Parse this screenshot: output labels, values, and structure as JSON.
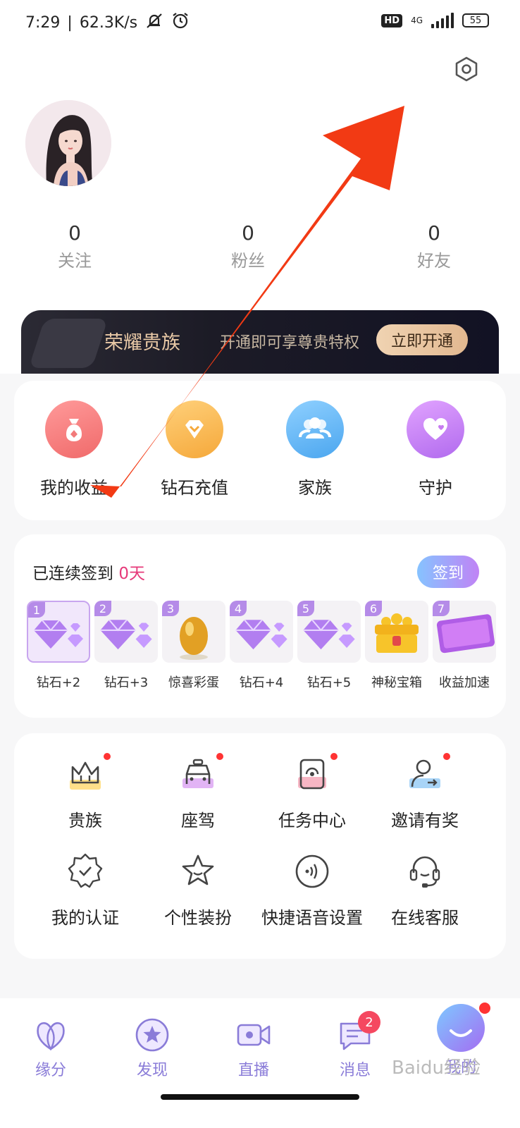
{
  "status": {
    "time": "7:29",
    "speed": "62.3K/s",
    "hd": "HD",
    "network": "4G",
    "battery": "55"
  },
  "profile": {
    "stats": [
      {
        "value": "0",
        "label": "关注"
      },
      {
        "value": "0",
        "label": "粉丝"
      },
      {
        "value": "0",
        "label": "好友"
      }
    ]
  },
  "vip": {
    "title": "荣耀贵族",
    "subtitle": "开通即可享尊贵特权",
    "button": "立即开通"
  },
  "quick_actions": [
    {
      "label": "我的收益",
      "icon": "money-bag-icon",
      "color": "#f27a7a"
    },
    {
      "label": "钻石充值",
      "icon": "diamond-icon",
      "color": "#f7b648"
    },
    {
      "label": "家族",
      "icon": "group-icon",
      "color": "#5aaef2"
    },
    {
      "label": "守护",
      "icon": "heart-icon",
      "color": "#c77cf0"
    }
  ],
  "signin": {
    "title": "已连续签到",
    "days": "0天",
    "button": "签到",
    "rewards": [
      {
        "day": "1",
        "label": "钻石+2"
      },
      {
        "day": "2",
        "label": "钻石+3"
      },
      {
        "day": "3",
        "label": "惊喜彩蛋"
      },
      {
        "day": "4",
        "label": "钻石+4"
      },
      {
        "day": "5",
        "label": "钻石+5"
      },
      {
        "day": "6",
        "label": "神秘宝箱"
      },
      {
        "day": "7",
        "label": "收益加速"
      }
    ]
  },
  "features": [
    {
      "label": "贵族",
      "icon": "crown-icon"
    },
    {
      "label": "座驾",
      "icon": "car-icon"
    },
    {
      "label": "任务中心",
      "icon": "task-icon"
    },
    {
      "label": "邀请有奖",
      "icon": "invite-icon"
    },
    {
      "label": "我的认证",
      "icon": "verified-icon"
    },
    {
      "label": "个性装扮",
      "icon": "star-icon"
    },
    {
      "label": "快捷语音设置",
      "icon": "voice-icon"
    },
    {
      "label": "在线客服",
      "icon": "headset-icon"
    }
  ],
  "tabs": [
    {
      "label": "缘分",
      "icon": "fate-icon"
    },
    {
      "label": "发现",
      "icon": "discover-icon"
    },
    {
      "label": "直播",
      "icon": "live-icon"
    },
    {
      "label": "消息",
      "icon": "message-icon",
      "badge": "2"
    },
    {
      "label": "我的",
      "icon": "profile-icon"
    }
  ],
  "watermark": "Baidu经验"
}
